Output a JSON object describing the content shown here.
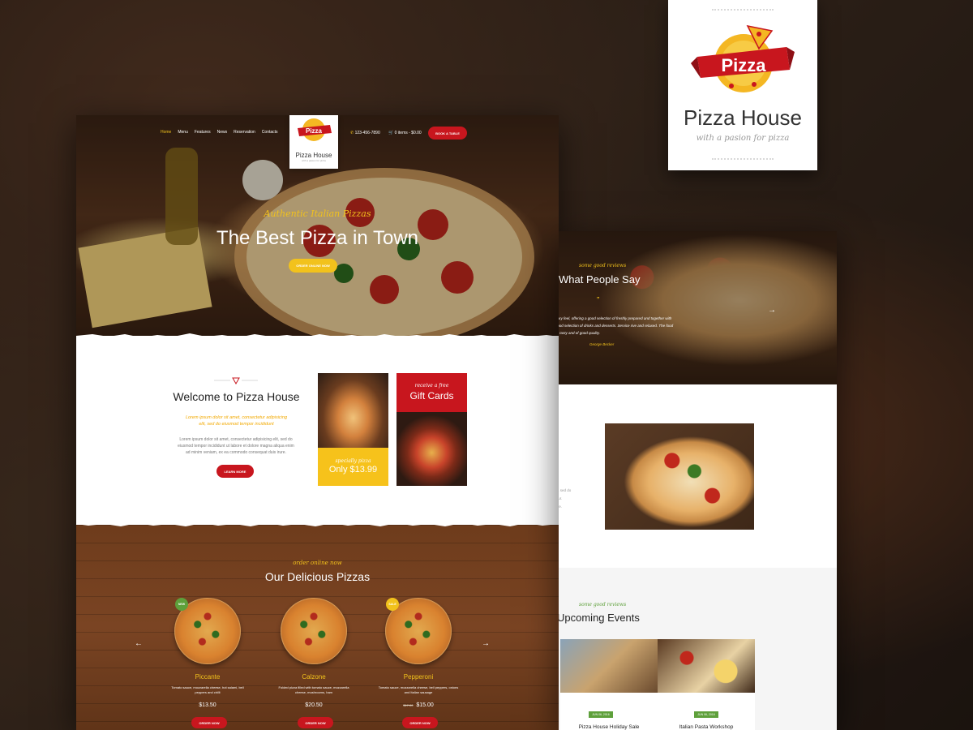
{
  "colors": {
    "red": "#c8161e",
    "yellow": "#f2c21c",
    "green": "#5ea03b",
    "wood": "#7a4423"
  },
  "logo_card": {
    "logo_word": "Pizza",
    "title": "Pizza House",
    "subtitle": "with a pasion for pizza"
  },
  "left": {
    "nav": [
      "Home",
      "Menu",
      "Features",
      "News",
      "Reservation",
      "Contacts"
    ],
    "logo_mini_word": "Pizza",
    "logo_mini_title": "Pizza House",
    "logo_mini_sub": "with a pasion for pizza",
    "phone": "123-456-7890",
    "cart": "0 items - $0.00",
    "book_button": "BOOK A TABLE",
    "hero": {
      "script": "Authentic Italian Pizzas",
      "title": "The Best Pizza in Town",
      "button": "ORDER ONLINE NOW"
    },
    "welcome": {
      "title": "Welcome to Pizza House",
      "italic": "Lorem ipsum dolor sit amet, consectetur adipisicing elit, sed do eiusmod tempor incididunt",
      "body": "Lorem ipsum dolor sit amet, consectetur adipisicing elit, sed do eiusmod tempor incididunt ut labore et dolore magna aliqua enim ad minim veniam, ex ea commodo consequat duis irure.",
      "button": "LEARN MORE"
    },
    "cards": {
      "special_script": "specially pizza",
      "special_price": "Only $13.99",
      "gift_script": "receive a free",
      "gift_title": "Gift Cards"
    },
    "menu": {
      "script": "order online now",
      "title": "Our Delicious Pizzas",
      "prev": "←",
      "next": "→",
      "items": [
        {
          "badge": "NEW",
          "name": "Piccante",
          "desc": "Tomato sauce, mozzarella cheese, hot salami, bell peppers and chilli",
          "old_price": "",
          "price": "$13.50",
          "button": "ORDER NOW"
        },
        {
          "badge": "",
          "name": "Calzone",
          "desc": "Folded pizza filled with tomato sauce, mozzarella cheese, mushrooms, ham",
          "old_price": "",
          "price": "$20.50",
          "button": "ORDER NOW"
        },
        {
          "badge": "SALE",
          "name": "Pepperoni",
          "desc": "Tomato sauce, mozzarella cheese, bell peppers, onions and Italian sausage",
          "old_price": "$17.00",
          "price": "$15.00",
          "button": "ORDER NOW"
        }
      ]
    }
  },
  "right": {
    "reviews": {
      "script": "some good reviews",
      "title": "What People Say",
      "quote_mark": "”",
      "text": "porary feel, offering a good selection of freshly prepared and together with a good selection of drinks and desserts. Service rive and relaxed. The food was tasty and of good quality.",
      "author": "George Becker",
      "next": "→"
    },
    "fragment_lines": [
      ",, sed do",
      "tur.",
      "ve."
    ],
    "events": {
      "script": "some good reviews",
      "title": "Upcoming Events",
      "items": [
        {
          "date": "JUN 06, 2016",
          "name": "Pizza House Holiday Sale"
        },
        {
          "date": "JUN 06, 2016",
          "name": "Italian Pasta Workshop"
        }
      ]
    }
  }
}
